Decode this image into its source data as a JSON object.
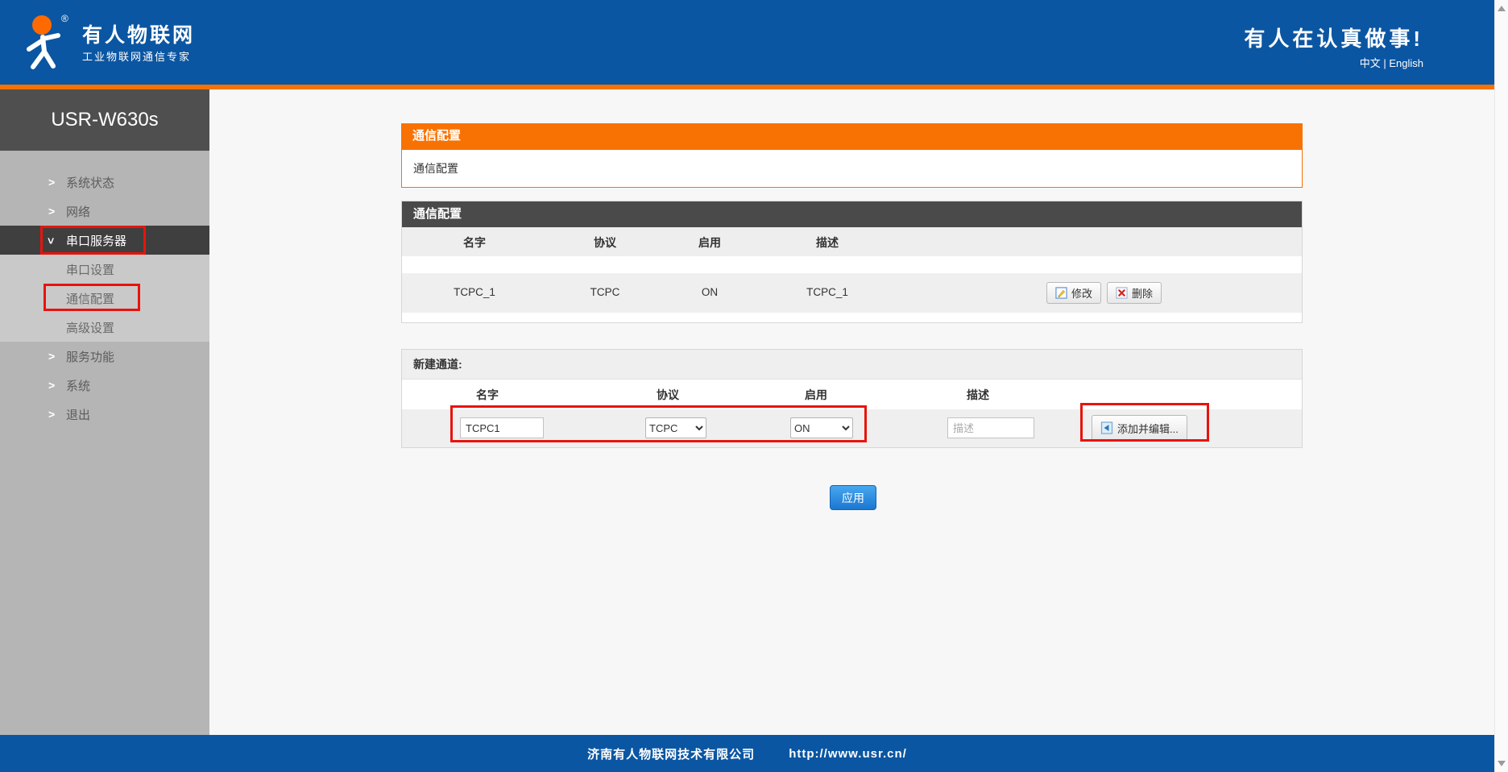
{
  "header": {
    "brand_name": "有人物联网",
    "brand_subtitle": "工业物联网通信专家",
    "registered_mark": "®",
    "tagline": "有人在认真做事!",
    "lang_zh": "中文",
    "lang_sep": "|",
    "lang_en": "English"
  },
  "sidebar": {
    "device_model": "USR-W630s",
    "items": [
      {
        "label": "系统状态"
      },
      {
        "label": "网络"
      },
      {
        "label": "串口服务器"
      },
      {
        "label": "串口设置"
      },
      {
        "label": "通信配置"
      },
      {
        "label": "高级设置"
      },
      {
        "label": "服务功能"
      },
      {
        "label": "系统"
      },
      {
        "label": "退出"
      }
    ]
  },
  "icons": {
    "chevron_right": ">",
    "chevron_down": ">"
  },
  "main": {
    "page_header": {
      "title": "通信配置",
      "subtitle": "通信配置"
    },
    "table": {
      "title": "通信配置",
      "columns": [
        "名字",
        "协议",
        "启用",
        "描述"
      ],
      "rows": [
        {
          "name": "TCPC_1",
          "protocol": "TCPC",
          "enabled": "ON",
          "description": "TCPC_1"
        }
      ],
      "edit_label": "修改",
      "delete_label": "删除"
    },
    "new_channel": {
      "title": "新建通道:",
      "columns": [
        "名字",
        "协议",
        "启用",
        "描述"
      ],
      "name_value": "TCPC1",
      "protocol_value": "TCPC",
      "enabled_value": "ON",
      "description_placeholder": "描述",
      "add_button_label": "添加并编辑..."
    },
    "apply_label": "应用"
  },
  "footer": {
    "company": "济南有人物联网技术有限公司",
    "website": "http://www.usr.cn/"
  },
  "colors": {
    "header_blue": "#0b56a2",
    "accent_orange": "#f87203",
    "annotation_red": "#e8130c",
    "table_header_gray": "#4a4a4a"
  }
}
